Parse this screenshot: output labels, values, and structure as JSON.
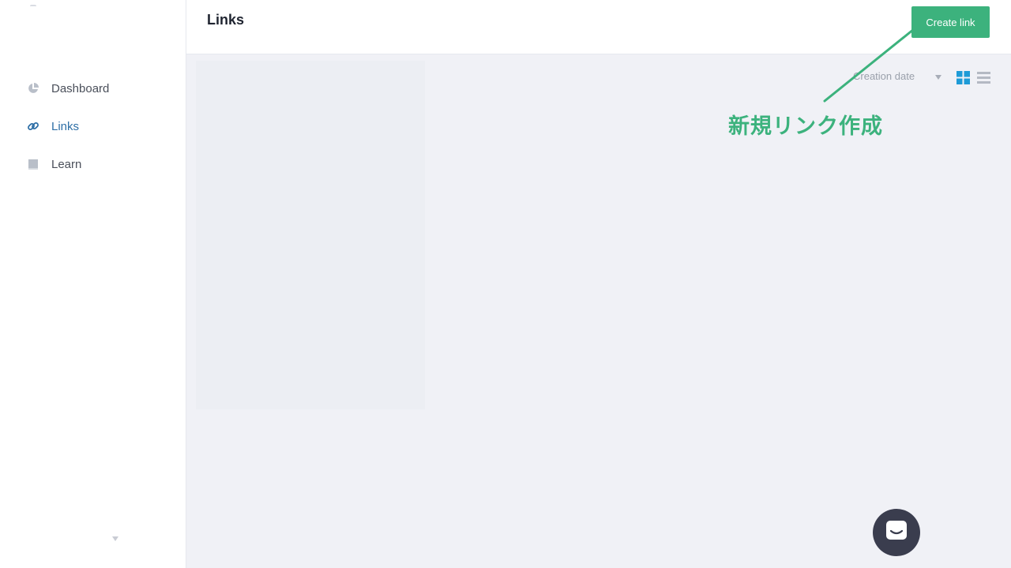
{
  "sidebar": {
    "items": [
      {
        "label": "Dashboard",
        "icon": "pie-chart-icon",
        "active": false
      },
      {
        "label": "Links",
        "icon": "link-icon",
        "active": true
      },
      {
        "label": "Learn",
        "icon": "book-icon",
        "active": false
      }
    ]
  },
  "header": {
    "title": "Links",
    "create_label": "Create link"
  },
  "toolbar": {
    "sort_label": "Creation date",
    "view_mode": "grid"
  },
  "annotation": {
    "text": "新規リンク作成"
  },
  "colors": {
    "accent_green": "#3cb27d",
    "active_blue": "#2e6fa6",
    "toggle_blue": "#1e9bd7",
    "chat_bg": "#3a3d4e"
  },
  "icons": {
    "chat": "chat-bubble-icon",
    "grid_view": "grid-view-icon",
    "list_view": "list-view-icon"
  }
}
